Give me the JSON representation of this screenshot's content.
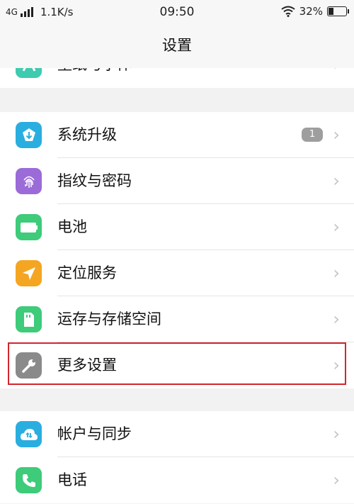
{
  "status_bar": {
    "network": "4G",
    "speed": "1.1K/s",
    "time": "09:50",
    "battery_pct": "32%",
    "battery_level": 0.32
  },
  "nav": {
    "title": "设置"
  },
  "group0": {
    "partial_label": "壁纸与字体"
  },
  "group1": [
    {
      "label": "系统升级",
      "icon": "system-update-icon",
      "color": "#2aaee0",
      "badge": "1"
    },
    {
      "label": "指纹与密码",
      "icon": "fingerprint-icon",
      "color": "#9b6bd8"
    },
    {
      "label": "电池",
      "icon": "battery-icon",
      "color": "#3ecb7a"
    },
    {
      "label": "定位服务",
      "icon": "location-icon",
      "color": "#f4a623"
    },
    {
      "label": "运存与存储空间",
      "icon": "storage-icon",
      "color": "#3ecb7a"
    },
    {
      "label": "更多设置",
      "icon": "wrench-icon",
      "color": "#8a8a8a"
    }
  ],
  "group2": [
    {
      "label": "帐户与同步",
      "icon": "cloud-sync-icon",
      "color": "#2aaee0"
    },
    {
      "label": "电话",
      "icon": "phone-icon",
      "color": "#3ecb7a"
    }
  ],
  "highlight_color": "#d2262b"
}
